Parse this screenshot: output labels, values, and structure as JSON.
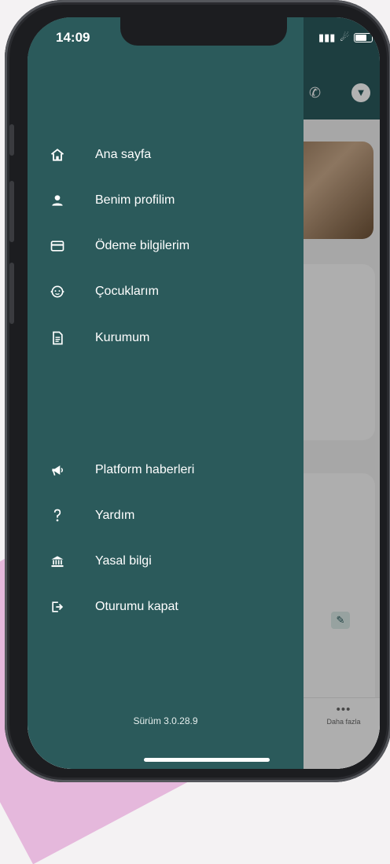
{
  "status_bar": {
    "time": "14:09"
  },
  "drawer": {
    "items": [
      {
        "label": "Ana sayfa",
        "icon": "home-icon"
      },
      {
        "label": "Benim profilim",
        "icon": "person-icon"
      },
      {
        "label": "Ödeme bilgilerim",
        "icon": "credit-card-icon"
      },
      {
        "label": "Çocuklarım",
        "icon": "child-face-icon"
      },
      {
        "label": "Kurumum",
        "icon": "document-icon"
      }
    ],
    "secondary_items": [
      {
        "label": "Platform haberleri",
        "icon": "megaphone-icon"
      },
      {
        "label": "Yardım",
        "icon": "question-icon"
      },
      {
        "label": "Yasal bilgi",
        "icon": "bank-icon"
      },
      {
        "label": "Oturumu kapat",
        "icon": "logout-icon"
      }
    ],
    "version": "Sürüm 3.0.28.9"
  },
  "background_app": {
    "bottom_nav_more_label": "Daha fazla"
  },
  "colors": {
    "drawer_bg": "#2b5a5b",
    "header_bg": "#2a5a5c",
    "text": "#ffffff"
  }
}
